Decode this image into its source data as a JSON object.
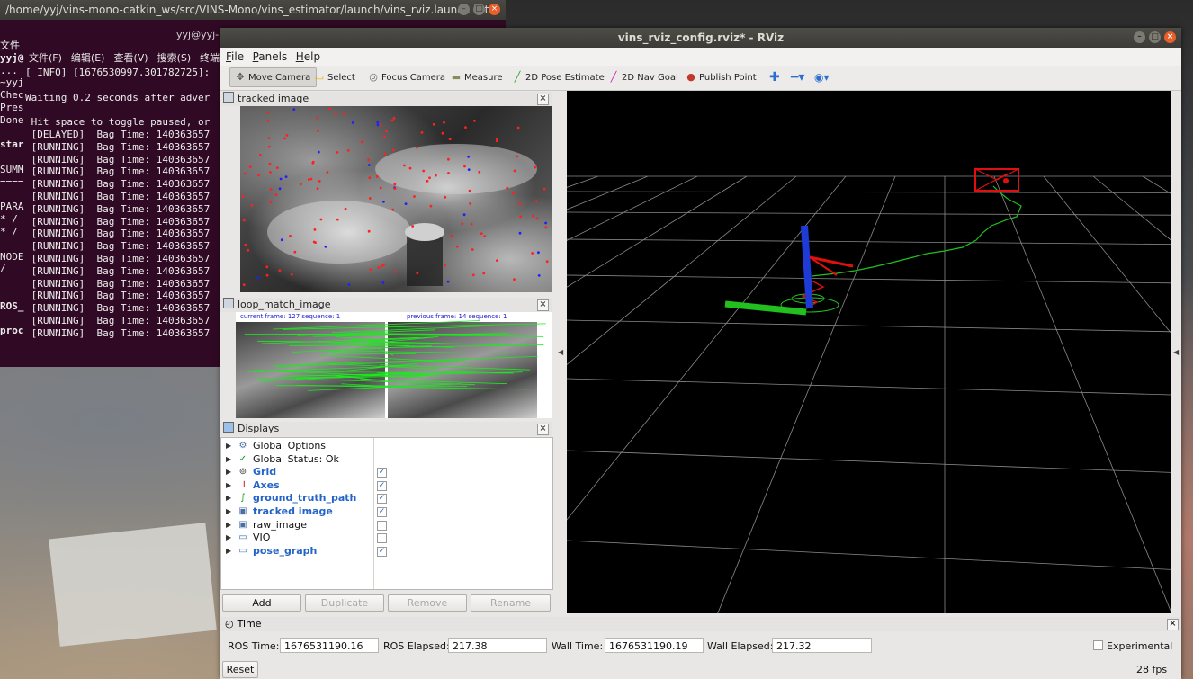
{
  "terminal": {
    "title": "/home/yyj/vins-mono-catkin_ws/src/VINS-Mono/vins_estimator/launch/vins_rviz.launch htt...",
    "inner_title": "yyj@yyj-",
    "menu": [
      "文件(F)",
      "编辑(E)",
      "查看(V)",
      "搜索(S)",
      "终端"
    ],
    "left_fragments": [
      "文件",
      "yyj@",
      "...",
      "~yyj",
      "Chec",
      "Pres",
      "Done",
      "",
      "star",
      "",
      "SUMM",
      "====",
      "",
      "PARA",
      " * /",
      " * /",
      "",
      "NODE",
      "  /",
      "",
      "",
      "ROS_",
      "",
      "proc",
      ""
    ],
    "lines": [
      "[ INFO] [1676530997.301782725]:",
      "",
      "Waiting 0.2 seconds after adver",
      "",
      " Hit space to toggle paused, or",
      " [DELAYED]  Bag Time: 140363657",
      " [RUNNING]  Bag Time: 140363657",
      " [RUNNING]  Bag Time: 140363657",
      " [RUNNING]  Bag Time: 140363657",
      " [RUNNING]  Bag Time: 140363657",
      " [RUNNING]  Bag Time: 140363657",
      " [RUNNING]  Bag Time: 140363657",
      " [RUNNING]  Bag Time: 140363657",
      " [RUNNING]  Bag Time: 140363657",
      " [RUNNING]  Bag Time: 140363657",
      " [RUNNING]  Bag Time: 140363657",
      " [RUNNING]  Bag Time: 140363657",
      " [RUNNING]  Bag Time: 140363657",
      " [RUNNING]  Bag Time: 140363657",
      " [RUNNING]  Bag Time: 140363657",
      " [RUNNING]  Bag Time: 140363657",
      " [RUNNING]  Bag Time: 140363657"
    ]
  },
  "rviz": {
    "title": "vins_rviz_config.rviz* - RViz",
    "menu": [
      "File",
      "Panels",
      "Help"
    ],
    "toolbar": [
      {
        "label": "Move Camera",
        "icon": "move-camera-icon",
        "glyph": "✥",
        "color": "#555555"
      },
      {
        "label": "Select",
        "icon": "select-icon",
        "glyph": "▭",
        "color": "#e0b000"
      },
      {
        "label": "Focus Camera",
        "icon": "focus-camera-icon",
        "glyph": "◎",
        "color": "#666666"
      },
      {
        "label": "Measure",
        "icon": "measure-icon",
        "glyph": "▬",
        "color": "#8a8a5a"
      },
      {
        "label": "2D Pose Estimate",
        "icon": "pose-estimate-icon",
        "glyph": "╱",
        "color": "#2ca02c"
      },
      {
        "label": "2D Nav Goal",
        "icon": "nav-goal-icon",
        "glyph": "╱",
        "color": "#d020b0"
      },
      {
        "label": "Publish Point",
        "icon": "publish-point-icon",
        "glyph": "●",
        "color": "#c0392b"
      }
    ],
    "panels": {
      "tracked_image": "tracked image",
      "loop_match_image": "loop_match_image",
      "loop_left_caption": "current frame: 127   sequence: 1",
      "loop_right_caption": "previous frame: 14   sequence: 1",
      "displays": "Displays",
      "time": "Time"
    },
    "displays": [
      {
        "name": "Global Options",
        "icon": "gear-icon",
        "glyph": "⚙",
        "enabled": false,
        "check": null
      },
      {
        "name": "Global Status: Ok",
        "icon": "status-ok-icon",
        "glyph": "✓",
        "enabled": false,
        "check": null
      },
      {
        "name": "Grid",
        "icon": "grid-icon",
        "glyph": "⊚",
        "enabled": true,
        "check": true
      },
      {
        "name": "Axes",
        "icon": "axes-icon",
        "glyph": "⅃",
        "enabled": true,
        "check": true
      },
      {
        "name": "ground_truth_path",
        "icon": "path-icon",
        "glyph": "∫",
        "enabled": true,
        "check": true
      },
      {
        "name": "tracked image",
        "icon": "image-icon",
        "glyph": "▣",
        "enabled": true,
        "check": true
      },
      {
        "name": "raw_image",
        "icon": "image-icon",
        "glyph": "▣",
        "enabled": false,
        "check": false
      },
      {
        "name": "VIO",
        "icon": "folder-icon",
        "glyph": "▭",
        "enabled": false,
        "check": false
      },
      {
        "name": "pose_graph",
        "icon": "folder-icon",
        "glyph": "▭",
        "enabled": true,
        "check": true
      }
    ],
    "display_buttons": [
      "Add",
      "Duplicate",
      "Remove",
      "Rename"
    ],
    "time": {
      "ros_time_label": "ROS Time:",
      "ros_time": "1676531190.16",
      "ros_elapsed_label": "ROS Elapsed:",
      "ros_elapsed": "217.38",
      "wall_time_label": "Wall Time:",
      "wall_time": "1676531190.19",
      "wall_elapsed_label": "Wall Elapsed:",
      "wall_elapsed": "217.32",
      "experimental_label": "Experimental",
      "reset_label": "Reset",
      "fps": "28 fps"
    }
  },
  "colors": {
    "terminal_bg": "#300a24",
    "enabled_display": "#2464c8",
    "axis_z": "#1f3bd6",
    "axis_x": "#22c01f",
    "trajectory": "#22c01f",
    "frame_marker": "#e01010"
  }
}
